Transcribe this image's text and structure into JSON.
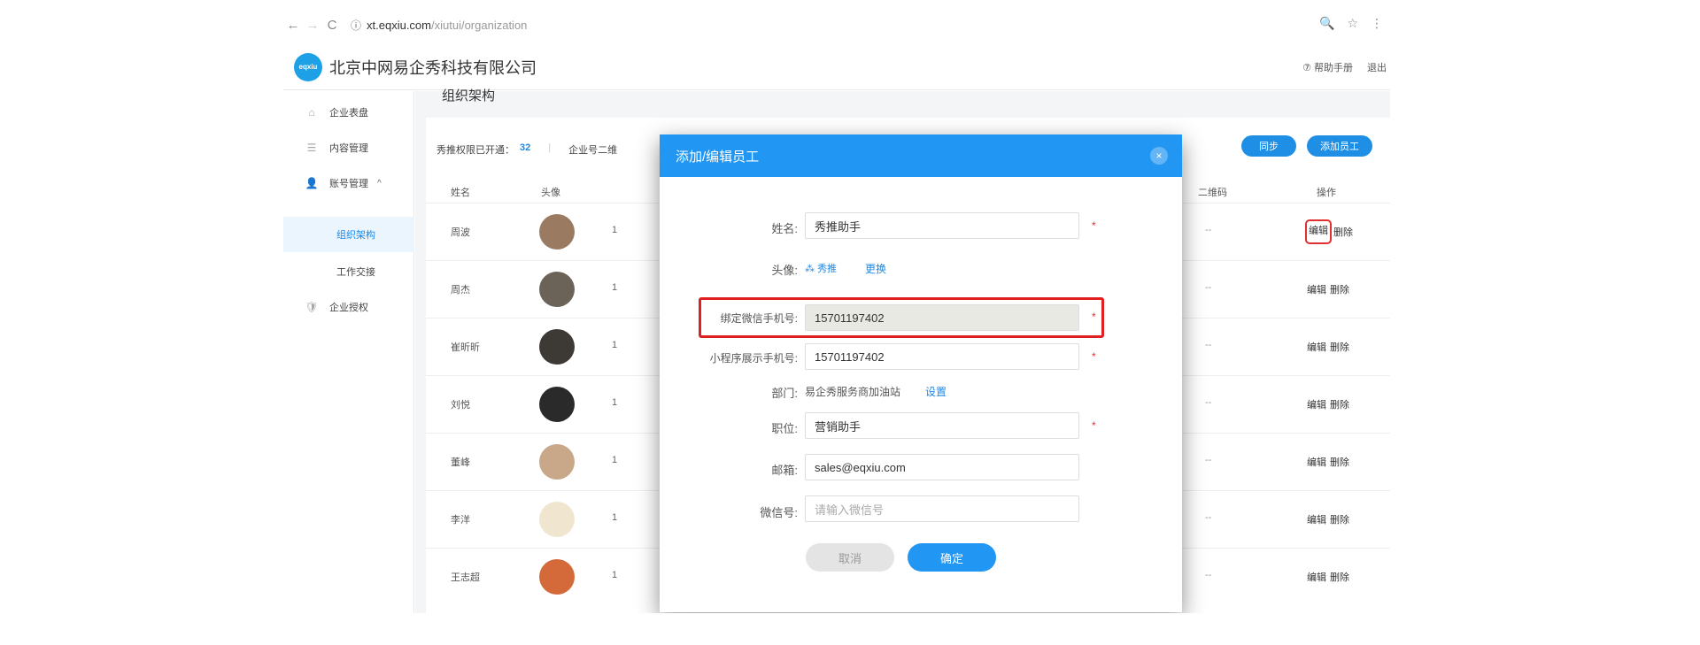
{
  "browser": {
    "back": "←",
    "forward": "→",
    "reload": "C",
    "info": "ⓘ",
    "url_host": "xt.eqxiu.com",
    "url_path": "/xiutui/organization",
    "icons_right": [
      "🔍",
      "☆",
      "⋮"
    ]
  },
  "header": {
    "logo_text": "eqxiu",
    "company": "北京中网易企秀科技有限公司",
    "help": "⑦ 帮助手册",
    "logout": "退出"
  },
  "sidebar": {
    "items": [
      {
        "icon": "home-icon",
        "glyph": "⌂",
        "label": "企业表盘"
      },
      {
        "icon": "list-icon",
        "glyph": "☰",
        "label": "内容管理"
      },
      {
        "icon": "user-icon",
        "glyph": "👤",
        "label": "账号管理",
        "chevron": "^"
      },
      {
        "label": "组织架构"
      },
      {
        "label": "工作交接"
      },
      {
        "icon": "shield-icon",
        "glyph": "🛡",
        "label": "企业授权"
      }
    ]
  },
  "main": {
    "title": "组织架构",
    "info": {
      "label": "秀推权限已开通：",
      "count": "32",
      "label2": "企业号二维"
    },
    "sync": "同步",
    "add": "添加员工",
    "headers": {
      "name": "姓名",
      "avatar": "头像",
      "qr": "二维码",
      "ops": "操作"
    },
    "rows": [
      {
        "name": "周波",
        "frag": "1",
        "qr": "--",
        "edit": "编辑",
        "del": "删除",
        "color": "#9a7b62"
      },
      {
        "name": "周杰",
        "frag": "1",
        "qr": "--",
        "edit": "编辑",
        "del": "删除",
        "color": "#6b6258"
      },
      {
        "name": "崔昕昕",
        "frag": "1",
        "qr": "--",
        "edit": "编辑",
        "del": "删除",
        "color": "#3d3a36"
      },
      {
        "name": "刘悦",
        "frag": "1",
        "qr": "--",
        "edit": "编辑",
        "del": "删除",
        "color": "#2a2a2a"
      },
      {
        "name": "董峰",
        "frag": "1",
        "qr": "--",
        "edit": "编辑",
        "del": "删除",
        "color": "#c9a88a"
      },
      {
        "name": "李洋",
        "frag": "1",
        "qr": "--",
        "edit": "编辑",
        "del": "删除",
        "color": "#f0e6d0"
      },
      {
        "name": "王志超",
        "frag": "1",
        "qr": "--",
        "edit": "编辑",
        "del": "删除",
        "color": "#d46a3a"
      }
    ]
  },
  "modal": {
    "title": "添加/编辑员工",
    "close": "×",
    "name_label": "姓名:",
    "name_value": "秀推助手",
    "avatar_label": "头像:",
    "avatar_logo": "秀推",
    "avatar_change": "更换",
    "wx_phone_label": "绑定微信手机号:",
    "wx_phone_value": "15701197402",
    "mp_phone_label": "小程序展示手机号:",
    "mp_phone_value": "15701197402",
    "dept_label": "部门:",
    "dept_value": "易企秀服务商加油站",
    "dept_set": "设置",
    "pos_label": "职位:",
    "pos_value": "营销助手",
    "mail_label": "邮箱:",
    "mail_value": "sales@eqxiu.com",
    "wx_label": "微信号:",
    "wx_placeholder": "请输入微信号",
    "required": "*",
    "cancel": "取消",
    "ok": "确定"
  }
}
